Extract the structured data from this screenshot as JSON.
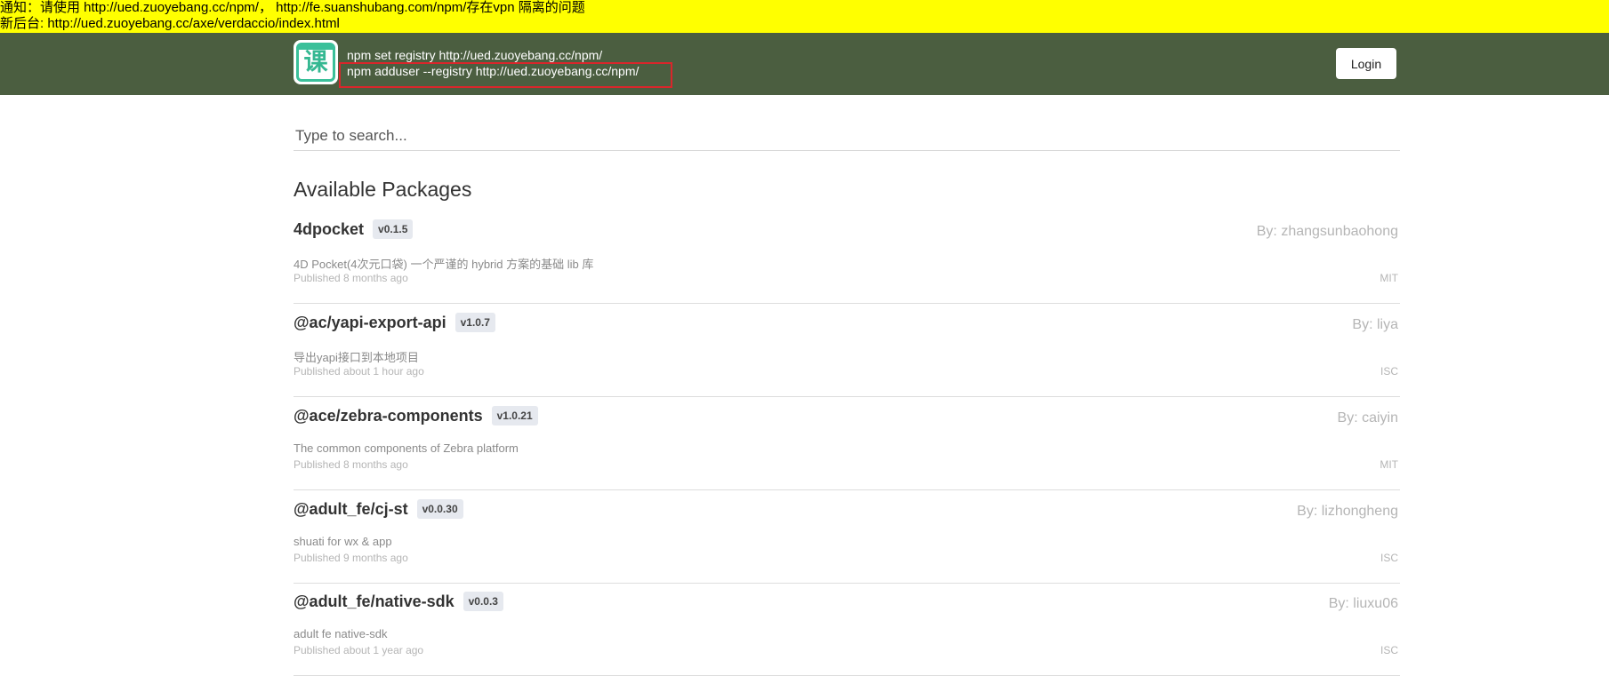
{
  "notice": {
    "line1": "通知：请使用 http://ued.zuoyebang.cc/npm/，  http://fe.suanshubang.com/npm/存在vpn 隔离的问题",
    "line2": "新后台: http://ued.zuoyebang.cc/axe/verdaccio/index.html"
  },
  "header": {
    "logo_text": "课",
    "cmd_set_registry": "npm set registry http://ued.zuoyebang.cc/npm/",
    "cmd_adduser": "npm adduser --registry http://ued.zuoyebang.cc/npm/",
    "login_label": "Login"
  },
  "search": {
    "placeholder": "Type to search..."
  },
  "main": {
    "section_title": "Available Packages",
    "packages": [
      {
        "name": "4dpocket",
        "version": "v0.1.5",
        "author": "By: zhangsunbaohong",
        "description": "4D Pocket(4次元口袋) 一个严谨的 hybrid 方案的基础 lib 库",
        "published": "Published 8 months ago",
        "license": "MIT"
      },
      {
        "name": "@ac/yapi-export-api",
        "version": "v1.0.7",
        "author": "By: liya",
        "description": "导出yapi接口到本地项目",
        "published": "Published about 1 hour ago",
        "license": "ISC"
      },
      {
        "name": "@ace/zebra-components",
        "version": "v1.0.21",
        "author": "By: caiyin",
        "description": "The common components of Zebra platform",
        "published": "Published 8 months ago",
        "license": "MIT"
      },
      {
        "name": "@adult_fe/cj-st",
        "version": "v0.0.30",
        "author": "By: lizhongheng",
        "description": "shuati for wx & app",
        "published": "Published 9 months ago",
        "license": "ISC"
      },
      {
        "name": "@adult_fe/native-sdk",
        "version": "v0.0.3",
        "author": "By: liuxu06",
        "description": "adult fe native-sdk",
        "published": "Published about 1 year ago",
        "license": "ISC"
      }
    ]
  },
  "colors": {
    "notice_bg": "#ffff00",
    "header_bg": "#4b5e40",
    "highlight_border": "#d9262b",
    "logo_accent": "#3bc09a"
  }
}
